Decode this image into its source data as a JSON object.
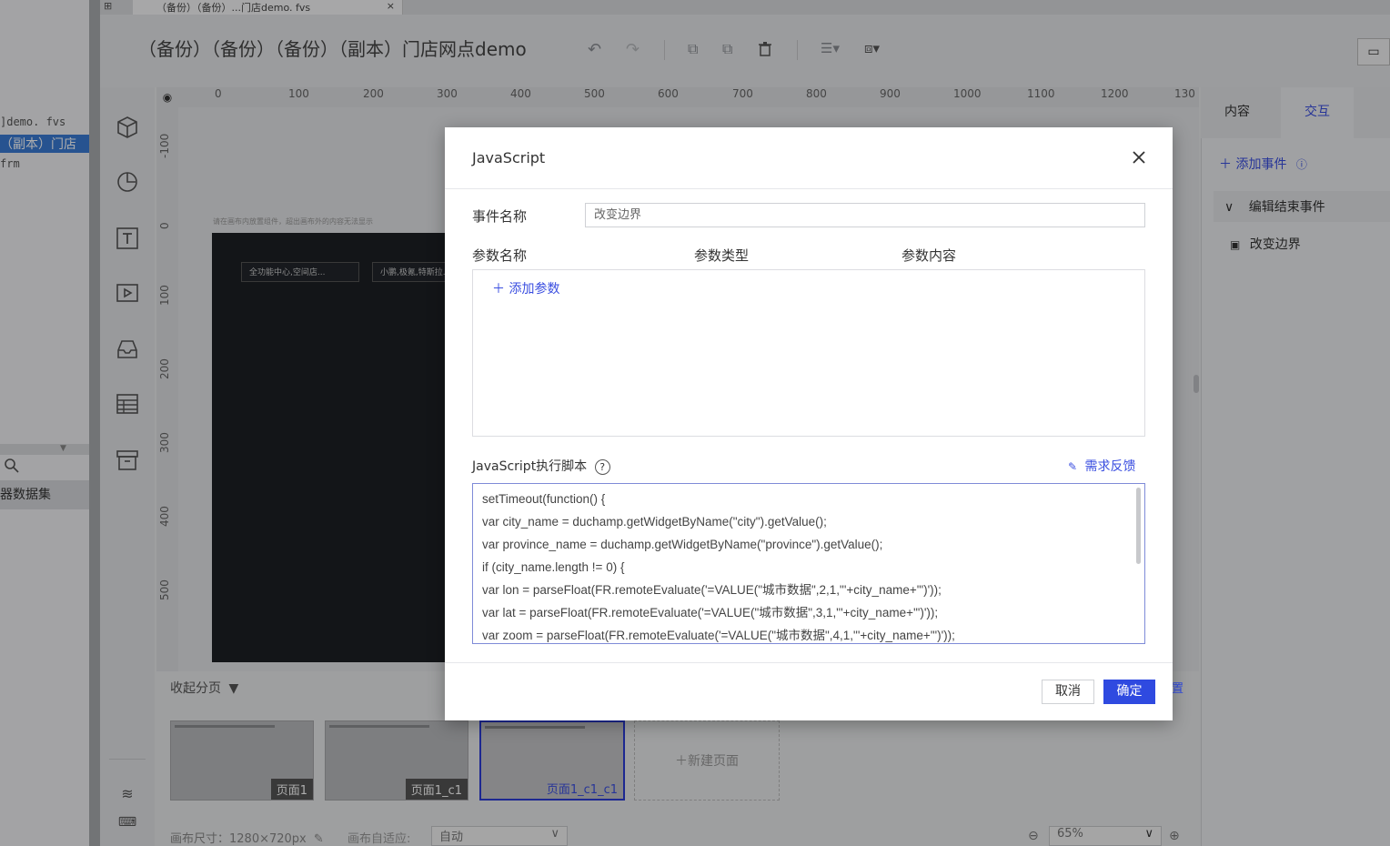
{
  "left_panel": {
    "files": [
      "]demo. fvs",
      "（副本）门店",
      "frm"
    ],
    "search_icon": "search-icon",
    "dataset_label": "器数据集"
  },
  "tab": {
    "label": "（备份）（备份）...门店demo. fvs",
    "close": "×"
  },
  "toolbar": {
    "title": "（备份）（备份）（备份）（副本）门店网点demo"
  },
  "ruler": {
    "top": [
      "0",
      "100",
      "200",
      "300",
      "400",
      "500",
      "600",
      "700",
      "800",
      "900",
      "1000",
      "1100",
      "1200",
      "130"
    ],
    "left": [
      "-100",
      "0",
      "100",
      "200",
      "300",
      "400",
      "500"
    ]
  },
  "canvas": {
    "hint": "请在画布内放置组件，超出画布外的内容无法显示",
    "select1": "全功能中心,空间店...",
    "select2": "小鹏,极氪,特斯拉..."
  },
  "pages": {
    "collapse_label": "收起分页",
    "items": [
      "页面1",
      "页面1_c1",
      "页面1_c1_c1"
    ],
    "new_page": "＋新建页面"
  },
  "status": {
    "canvas_size": "画布尺寸：1280×720px",
    "adapt_label": "画布自适应:",
    "adapt_value": "自动",
    "zoom": "65%"
  },
  "right_panel": {
    "tabs": [
      "内容",
      "交互"
    ],
    "add_event": "＋ 添加事件",
    "event_group": "编辑结束事件",
    "event_item": "改变边界",
    "partial_link": "置"
  },
  "dialog": {
    "title": "JavaScript",
    "event_name_label": "事件名称",
    "event_name_value": "改变边界",
    "param_headers": [
      "参数名称",
      "参数类型",
      "参数内容"
    ],
    "add_param": "＋ 添加参数",
    "script_label": "JavaScript执行脚本",
    "feedback": "需求反馈",
    "script_lines": [
      "setTimeout(function() {",
      "var city_name = duchamp.getWidgetByName(\"city\").getValue();",
      "var province_name = duchamp.getWidgetByName(\"province\").getValue();",
      "if (city_name.length != 0) {",
      "var lon = parseFloat(FR.remoteEvaluate('=VALUE(\"城市数据\",2,1,\"'+city_name+'\")'));",
      "var lat = parseFloat(FR.remoteEvaluate('=VALUE(\"城市数据\",3,1,\"'+city_name+'\")'));",
      "var zoom = parseFloat(FR.remoteEvaluate('=VALUE(\"城市数据\",4,1,\"'+city_name+'\")'));"
    ],
    "cancel": "取消",
    "ok": "确定"
  },
  "colors": {
    "accent": "#2f4ae0",
    "link": "#3a4ee0"
  }
}
